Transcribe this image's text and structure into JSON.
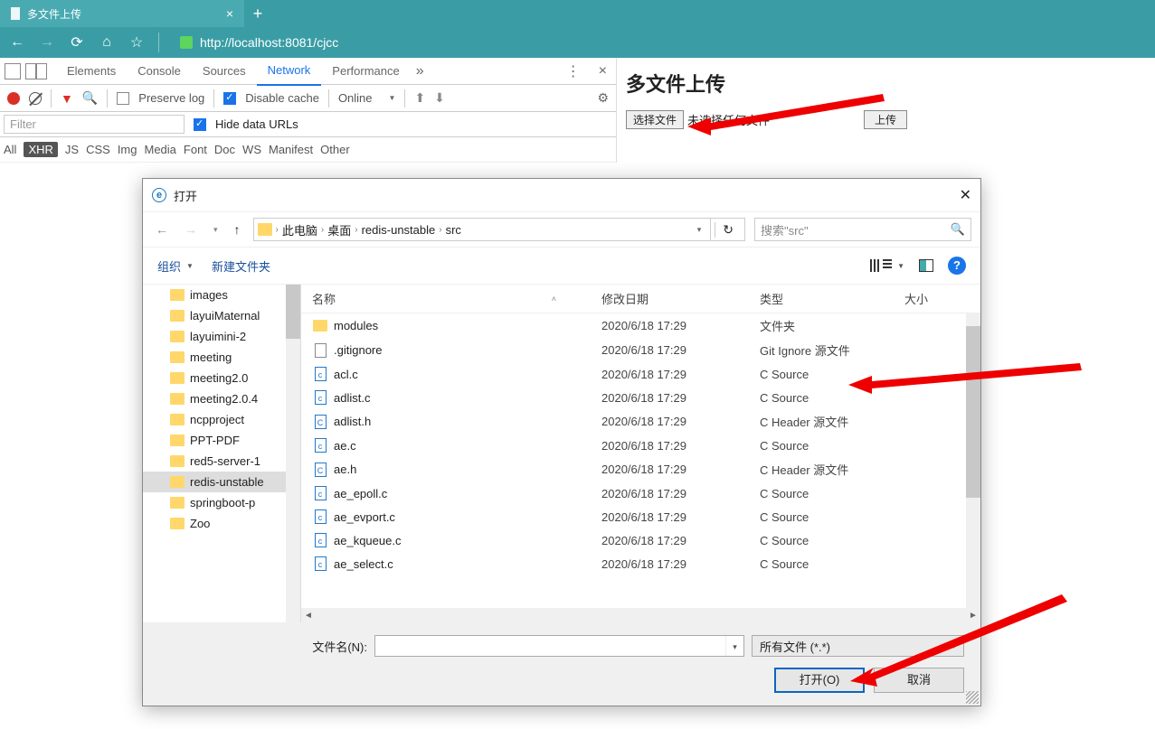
{
  "browser": {
    "tab_title": "多文件上传",
    "url": "http://localhost:8081/cjcc"
  },
  "devtools": {
    "tabs": [
      "Elements",
      "Console",
      "Sources",
      "Network",
      "Performance"
    ],
    "active_tab": "Network",
    "toolbar": {
      "preserve_log": "Preserve log",
      "disable_cache": "Disable cache",
      "throttle": "Online"
    },
    "filter_placeholder": "Filter",
    "hide_urls": "Hide data URLs",
    "types": [
      "All",
      "XHR",
      "JS",
      "CSS",
      "Img",
      "Media",
      "Font",
      "Doc",
      "WS",
      "Manifest",
      "Other"
    ],
    "selected_type": "XHR"
  },
  "page": {
    "heading": "多文件上传",
    "choose_btn": "选择文件",
    "no_file": "未选择任何文件",
    "upload_btn": "上传"
  },
  "dialog": {
    "title": "打开",
    "breadcrumb": [
      "此电脑",
      "桌面",
      "redis-unstable",
      "src"
    ],
    "search_placeholder": "搜索\"src\"",
    "toolbar": {
      "organize": "组织",
      "new_folder": "新建文件夹"
    },
    "tree": [
      "images",
      "layuiMaternal",
      "layuimini-2",
      "meeting",
      "meeting2.0",
      "meeting2.0.4",
      "ncpproject",
      "PPT-PDF",
      "red5-server-1",
      "redis-unstable",
      "springboot-p",
      "Zoo"
    ],
    "tree_selected": "redis-unstable",
    "columns": {
      "name": "名称",
      "date": "修改日期",
      "type": "类型",
      "size": "大小"
    },
    "files": [
      {
        "kind": "folder",
        "name": "modules",
        "date": "2020/6/18 17:29",
        "type": "文件夹"
      },
      {
        "kind": "file",
        "name": ".gitignore",
        "date": "2020/6/18 17:29",
        "type": "Git Ignore 源文件"
      },
      {
        "kind": "c",
        "name": "acl.c",
        "date": "2020/6/18 17:29",
        "type": "C Source"
      },
      {
        "kind": "c",
        "name": "adlist.c",
        "date": "2020/6/18 17:29",
        "type": "C Source"
      },
      {
        "kind": "h",
        "name": "adlist.h",
        "date": "2020/6/18 17:29",
        "type": "C Header 源文件"
      },
      {
        "kind": "c",
        "name": "ae.c",
        "date": "2020/6/18 17:29",
        "type": "C Source"
      },
      {
        "kind": "h",
        "name": "ae.h",
        "date": "2020/6/18 17:29",
        "type": "C Header 源文件"
      },
      {
        "kind": "c",
        "name": "ae_epoll.c",
        "date": "2020/6/18 17:29",
        "type": "C Source"
      },
      {
        "kind": "c",
        "name": "ae_evport.c",
        "date": "2020/6/18 17:29",
        "type": "C Source"
      },
      {
        "kind": "c",
        "name": "ae_kqueue.c",
        "date": "2020/6/18 17:29",
        "type": "C Source"
      },
      {
        "kind": "c",
        "name": "ae_select.c",
        "date": "2020/6/18 17:29",
        "type": "C Source"
      }
    ],
    "filename_label": "文件名(N):",
    "filetype": "所有文件 (*.*)",
    "open_btn": "打开(O)",
    "cancel_btn": "取消"
  }
}
